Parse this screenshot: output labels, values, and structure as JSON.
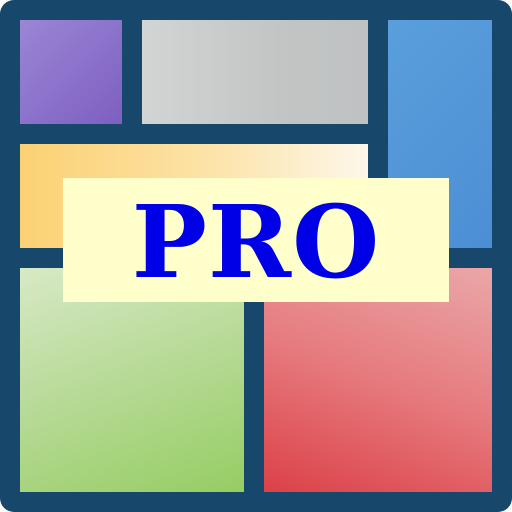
{
  "badge": {
    "label": "PRO"
  },
  "colors": {
    "frame": "#17476a",
    "purple_tile": "#8b70cc",
    "gray_tile": "#c7c9c9",
    "blue_tile": "#5496d8",
    "yellow_tile": "#fcd98c",
    "green_tile": "#a9d47f",
    "red_tile": "#e2666b",
    "label_background": "#ffffcc",
    "label_text": "#0000e6"
  }
}
